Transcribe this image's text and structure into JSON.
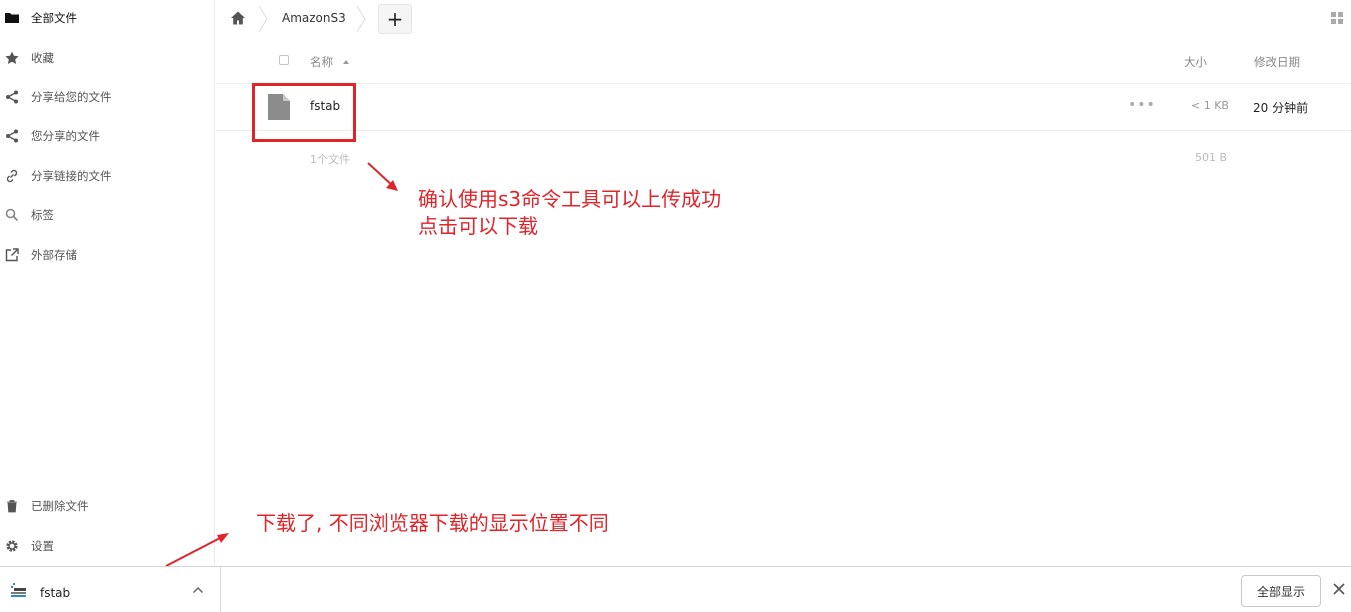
{
  "sidebar": {
    "items": [
      {
        "label": "全部文件",
        "icon": "folder-icon"
      },
      {
        "label": "收藏",
        "icon": "star-icon"
      },
      {
        "label": "分享给您的文件",
        "icon": "share-icon"
      },
      {
        "label": "您分享的文件",
        "icon": "share-icon"
      },
      {
        "label": "分享链接的文件",
        "icon": "link-icon"
      },
      {
        "label": "标签",
        "icon": "search-icon"
      },
      {
        "label": "外部存储",
        "icon": "external-icon"
      }
    ],
    "bottom": [
      {
        "label": "已删除文件",
        "icon": "trash-icon"
      },
      {
        "label": "设置",
        "icon": "gear-icon"
      }
    ]
  },
  "breadcrumb": {
    "current": "AmazonS3",
    "add_label": "+"
  },
  "table": {
    "headers": {
      "name": "名称",
      "size": "大小",
      "modified": "修改日期"
    },
    "rows": [
      {
        "name": "fstab",
        "size": "< 1 KB",
        "modified": "20 分钟前",
        "more": "•••"
      }
    ],
    "summary": {
      "count": "1个文件",
      "size": "501 B"
    }
  },
  "annotations": {
    "note1_line1": "确认使用s3命令工具可以上传成功",
    "note1_line2": "点击可以下载",
    "note2": "下载了, 不同浏览器下载的显示位置不同"
  },
  "download_bar": {
    "file_name": "fstab",
    "show_all": "全部显示"
  },
  "colors": {
    "annotation_red": "#e0242a"
  }
}
